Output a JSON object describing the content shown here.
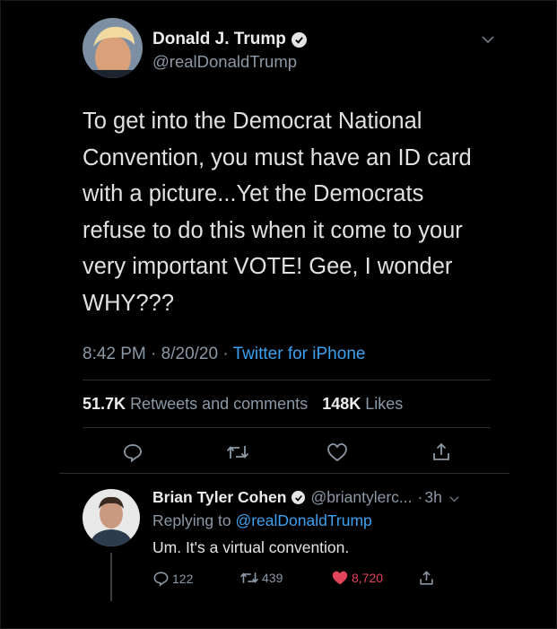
{
  "tweet": {
    "author": {
      "name": "Donald J. Trump",
      "handle": "@realDonaldTrump",
      "verified": true
    },
    "text": "To get into the Democrat National\nConvention, you must have an ID card\nwith a picture...Yet the Democrats\nrefuse to do this when it come to your\nvery important VOTE! Gee, I wonder\nWHY???",
    "time": "8:42 PM",
    "date": "8/20/20",
    "source": "Twitter for iPhone",
    "stats": {
      "retweets_count": "51.7K",
      "retweets_label": "Retweets and comments",
      "likes_count": "148K",
      "likes_label": "Likes"
    },
    "icons": [
      "reply-icon",
      "retweet-icon",
      "like-icon",
      "share-icon",
      "chevron-down-icon",
      "verified-badge-icon"
    ]
  },
  "reply": {
    "author": {
      "name": "Brian Tyler Cohen",
      "handle": "@briantylerc...",
      "verified": true
    },
    "age": "3h",
    "replying_prefix": "Replying to",
    "replying_to": "@realDonaldTrump",
    "text": "Um. It's a virtual convention.",
    "actions": {
      "replies": "122",
      "retweets": "439",
      "likes": "8,720"
    }
  },
  "colors": {
    "background": "#000000",
    "link": "#3ea1ef",
    "muted": "#8b98a5",
    "like": "#e2445c"
  }
}
